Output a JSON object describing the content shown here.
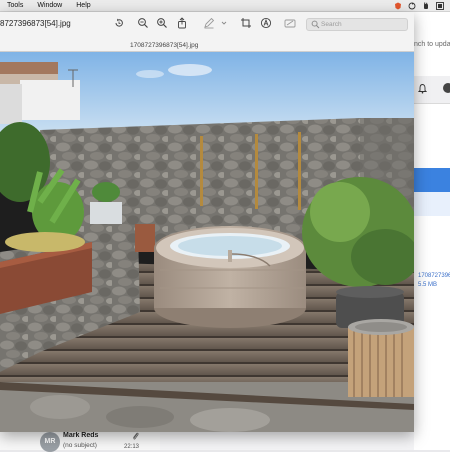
{
  "menubar": {
    "items": [
      "Tools",
      "Window",
      "Help"
    ]
  },
  "preview": {
    "title": "8727396873[54].jpg",
    "subtitle": "1708727396873[54].jpg",
    "search_placeholder": "Search",
    "toolbar_icons": [
      "rotate-icon",
      "zoom-out-icon",
      "zoom-in-icon",
      "share-icon",
      "markup-pen-icon",
      "chevron-down-icon",
      "crop-icon",
      "highlight-icon",
      "fill-form-icon"
    ]
  },
  "background_app": {
    "search_hint": "nch to upda",
    "attachment_name": "1708727396...",
    "attachment_size": "5.5 MB",
    "mail_row": {
      "avatar_initials": "MR",
      "sender": "Mark Reds",
      "subject": "(no subject)",
      "time": "22:13"
    }
  },
  "colors": {
    "sky": "#b9d6f2",
    "tub": "#b4a699",
    "deck": "#6f6256",
    "wall": "#7c7a74",
    "accent_blue": "#3b82e0"
  }
}
